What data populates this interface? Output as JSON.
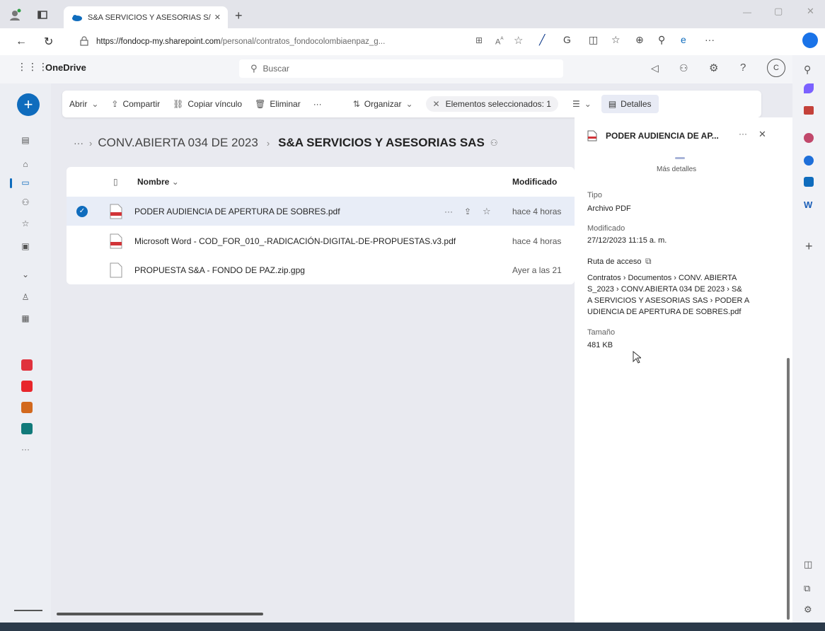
{
  "browser": {
    "tab_title": "S&A SERVICIOS Y ASESORIAS S/",
    "url_host": "https://fondocp-my.sharepoint.com",
    "url_path": "/personal/contratos_fondocolombiaenpaz_g..."
  },
  "app": {
    "name": "OneDrive",
    "search_placeholder": "Buscar",
    "avatar_initial": "C"
  },
  "commands": {
    "open": "Abrir",
    "share": "Compartir",
    "copy_link": "Copiar vínculo",
    "delete": "Eliminar",
    "more": "···",
    "sort": "Organizar",
    "selected": "Elementos seleccionados: 1",
    "details": "Detalles"
  },
  "breadcrumb": {
    "ellipsis": "···",
    "parent": "CONV.ABIERTA 034 DE 2023",
    "current": "S&A SERVICIOS Y ASESORIAS SAS"
  },
  "files": {
    "col_name": "Nombre",
    "col_modified": "Modificado",
    "rows": [
      {
        "name": "PODER AUDIENCIA DE APERTURA DE SOBRES.pdf",
        "modified": "hace 4 horas"
      },
      {
        "name": "Microsoft Word - COD_FOR_010_-RADICACIÓN-DIGITAL-DE-PROPUESTAS.v3.pdf",
        "modified": "hace 4 horas"
      },
      {
        "name": "PROPUESTA S&A - FONDO DE PAZ.zip.gpg",
        "modified": "Ayer a las 21"
      }
    ]
  },
  "details": {
    "title": "PODER AUDIENCIA DE AP...",
    "more": "···",
    "more_details": "Más detalles",
    "type_label": "Tipo",
    "type_value": "Archivo PDF",
    "modified_label": "Modificado",
    "modified_value": "27/12/2023 11:15 a. m.",
    "path_label": "Ruta de acceso",
    "path_lines": [
      "Contratos › Documentos › CONV. ABIERTA",
      "S_2023 › CONV.ABIERTA 034 DE 2023 › S&",
      "A SERVICIOS Y ASESORIAS SAS › PODER A",
      "UDIENCIA DE APERTURA DE SOBRES.pdf"
    ],
    "size_label": "Tamaño",
    "size_value": "481 KB"
  },
  "colors": {
    "accent": "#0f6cbd",
    "pdf_red": "#d13438"
  }
}
